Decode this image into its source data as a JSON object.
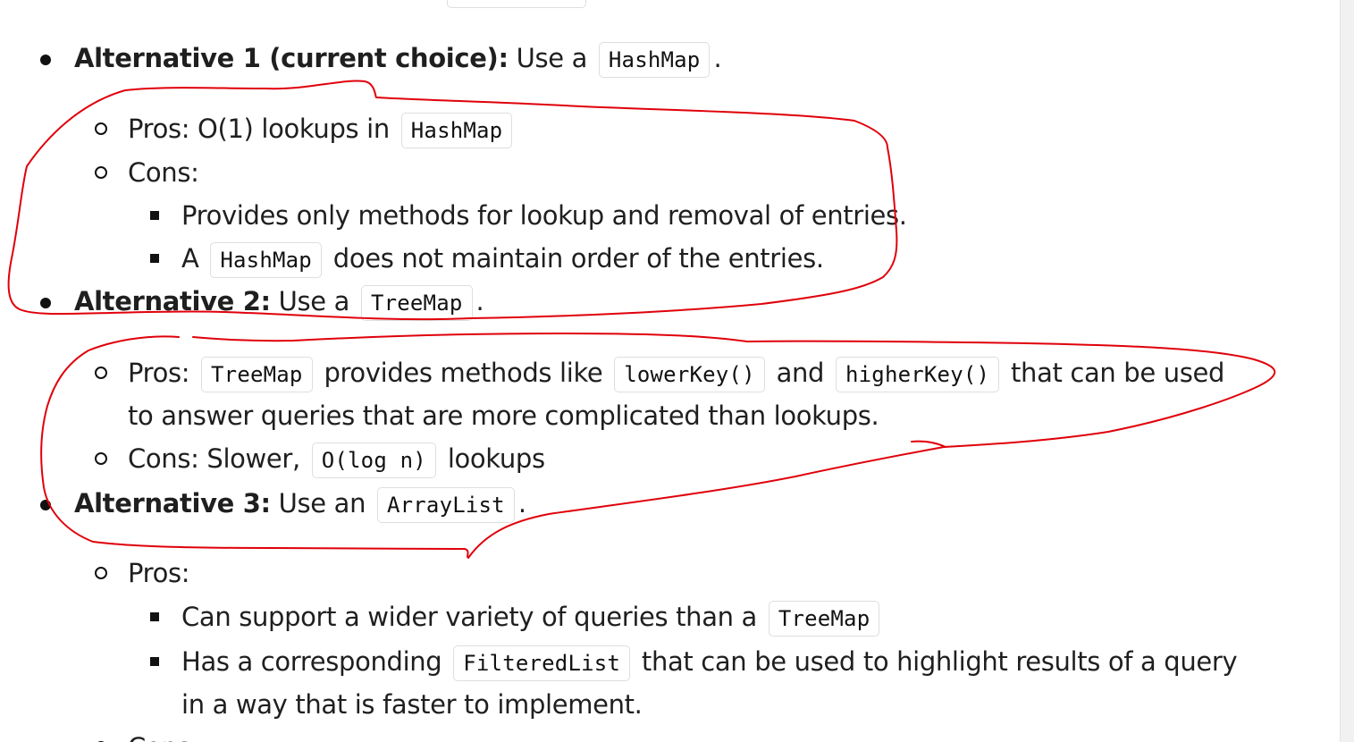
{
  "document": {
    "alternatives": [
      {
        "heading": "Alternative 1 (current choice):",
        "text_before": "Use a",
        "code": "HashMap",
        "text_after": ".",
        "pros_label": "Pros:",
        "pros_text": "O(1) lookups in",
        "pros_code": "HashMap",
        "cons_label": "Cons:",
        "cons_items": [
          {
            "text": "Provides only methods for lookup and removal of entries."
          },
          {
            "text_before": "A",
            "code": "HashMap",
            "text_after": "does not maintain order of the entries."
          }
        ]
      },
      {
        "heading": "Alternative 2:",
        "text_before": "Use a",
        "code": "TreeMap",
        "text_after": ".",
        "pros_label": "Pros:",
        "pros_code_1": "TreeMap",
        "pros_text_1": "provides methods like",
        "pros_code_2": "lowerKey()",
        "pros_text_2": "and",
        "pros_code_3": "higherKey()",
        "pros_text_3": "that can be used",
        "pros_text_4": "to answer queries that are more complicated than lookups.",
        "cons_label": "Cons:",
        "cons_text_1": "Slower,",
        "cons_code": "O(log n)",
        "cons_text_2": "lookups"
      },
      {
        "heading": "Alternative 3:",
        "text_before": "Use an",
        "code": "ArrayList",
        "text_after": ".",
        "pros_label": "Pros:",
        "pros_items": [
          {
            "text_before": "Can support a wider variety of queries than a",
            "code": "TreeMap"
          },
          {
            "text_before": "Has a corresponding",
            "code": "FilteredList",
            "text_after": "that can be used to highlight results of a query",
            "text_line2": "in a way that is faster to implement."
          }
        ],
        "cons_label": "Cons:"
      }
    ]
  },
  "annotation": {
    "color": "#e0000a"
  }
}
